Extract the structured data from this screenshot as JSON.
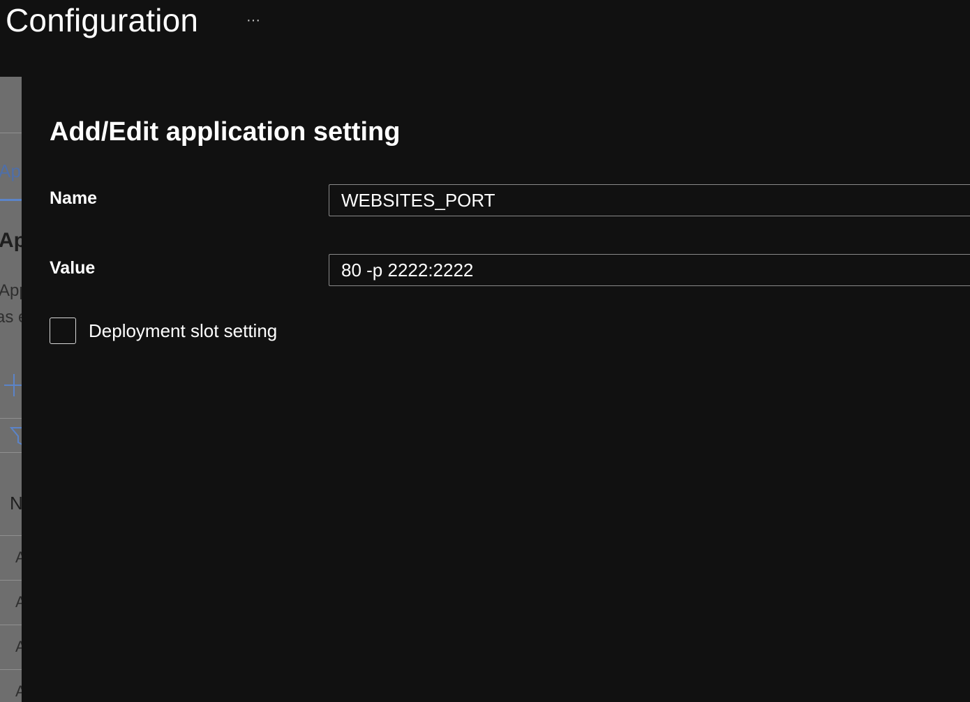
{
  "header": {
    "title": "Configuration",
    "more_label": "···"
  },
  "background_blade": {
    "tab_label_fragment": "App",
    "heading_fragment": "Ap",
    "desc_line1_fragment": "App",
    "desc_line2_fragment": "as e",
    "column_header_fragment": "N",
    "row_fragments": [
      "A",
      "A",
      "A",
      "A"
    ]
  },
  "panel": {
    "title": "Add/Edit application setting",
    "name_label": "Name",
    "name_value": "WEBSITES_PORT",
    "value_label": "Value",
    "value_value": "80 -p 2222:2222",
    "slot_setting_label": "Deployment slot setting",
    "slot_setting_checked": false
  },
  "colors": {
    "background": "#111111",
    "text": "#ffffff",
    "input_border": "#8a8a8a",
    "accent": "#5b84c9",
    "dimmed_blade": "#6e6e6e"
  }
}
